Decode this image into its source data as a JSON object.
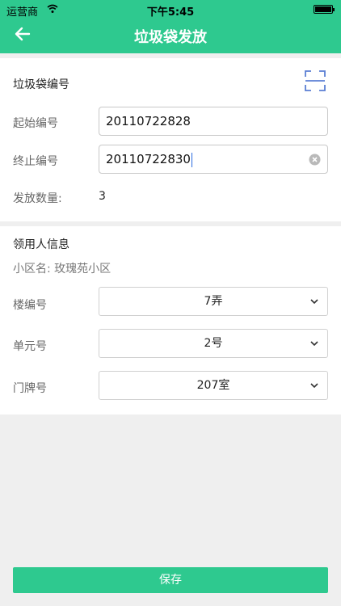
{
  "status_bar": {
    "carrier": "运营商",
    "time": "下午5:45"
  },
  "header": {
    "title": "垃圾袋发放"
  },
  "bag_section": {
    "title": "垃圾袋编号",
    "start_label": "起始编号",
    "start_value": "20110722828",
    "end_label": "终止编号",
    "end_value": "20110722830",
    "count_label": "发放数量:",
    "count_value": "3"
  },
  "recipient_section": {
    "title": "领用人信息",
    "community": "小区名: 玫瑰苑小区",
    "building_label": "楼编号",
    "building_value": "7弄",
    "unit_label": "单元号",
    "unit_value": "2号",
    "door_label": "门牌号",
    "door_value": "207室"
  },
  "footer": {
    "save_label": "保存"
  },
  "colors": {
    "accent": "#2ec98f",
    "scan_icon": "#5b7fd4"
  }
}
